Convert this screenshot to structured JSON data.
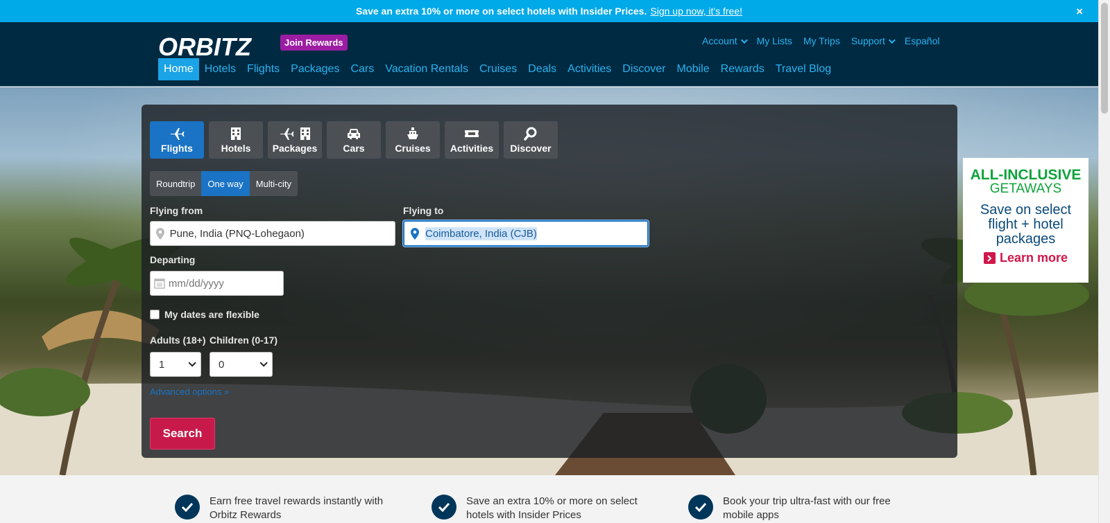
{
  "promo": {
    "text": "Save an extra 10% or more on select hotels with Insider Prices.",
    "link": "Sign up now, it's free!",
    "close": "×"
  },
  "header": {
    "logo_text": "ORBITZ",
    "join_rewards": "Join Rewards",
    "utility": {
      "account": "Account",
      "my_lists": "My Lists",
      "my_trips": "My Trips",
      "support": "Support",
      "espanol": "Español"
    },
    "nav": [
      "Home",
      "Hotels",
      "Flights",
      "Packages",
      "Cars",
      "Vacation Rentals",
      "Cruises",
      "Deals",
      "Activities",
      "Discover",
      "Mobile",
      "Rewards",
      "Travel Blog"
    ]
  },
  "search": {
    "tabs": [
      "Flights",
      "Hotels",
      "Packages",
      "Cars",
      "Cruises",
      "Activities",
      "Discover"
    ],
    "trip_types": [
      "Roundtrip",
      "One way",
      "Multi-city"
    ],
    "flying_from_label": "Flying from",
    "flying_from_value": "Pune, India (PNQ-Lohegaon)",
    "flying_to_label": "Flying to",
    "flying_to_value": "Coimbatore, India (CJB)",
    "departing_label": "Departing",
    "departing_placeholder": "mm/dd/yyyy",
    "flexible_label": "My dates are flexible",
    "adults_label": "Adults (18+)",
    "adults_value": "1",
    "children_label": "Children (0-17)",
    "children_value": "0",
    "advanced": "Advanced options »",
    "search_button": "Search"
  },
  "ad": {
    "line1": "ALL-INCLUSIVE",
    "line2": "GETAWAYS",
    "line3": "Save on select flight + hotel packages",
    "cta": "Learn more"
  },
  "benefits": [
    "Earn free travel rewards instantly with Orbitz Rewards",
    "Save an extra 10% or more on select hotels with Insider Prices",
    "Book your trip ultra-fast with our free mobile apps"
  ],
  "colors": {
    "promo_bg": "#00a9e8",
    "header_bg": "#002a42",
    "link": "#29b3f0",
    "active_tab": "#1a73c4",
    "search_button": "#c71a4a",
    "join_rewards": "#9c1da3"
  }
}
